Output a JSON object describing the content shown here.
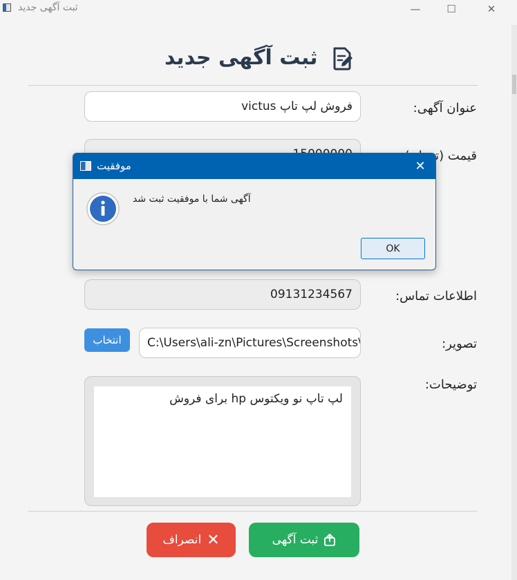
{
  "window": {
    "title": "ثبت آگهی جدید"
  },
  "form": {
    "heading": "ثبت آگهی جدید",
    "fields": {
      "title": {
        "label": "عنوان آگهی:",
        "value": "فروش لپ تاپ victus"
      },
      "price": {
        "label": "قیمت (تومان):",
        "value": "15000000"
      },
      "contact": {
        "label": "اطلاعات تماس:",
        "value": "09131234567"
      },
      "image": {
        "label": "تصویر:",
        "value": "C:\\Users\\ali-zn\\Pictures\\Screenshots\\Screenshot",
        "button": "انتخاب"
      },
      "description": {
        "label": "توضیحات:",
        "value": "لپ تاپ نو ویکتوس hp برای فروش"
      }
    },
    "buttons": {
      "submit": "ثبت آگهی",
      "cancel": "انصراف"
    }
  },
  "dialog": {
    "title": "موفقیت",
    "message": "آگهی شما با موفقیت ثبت شد",
    "ok": "OK"
  },
  "colors": {
    "submit": "#27ae60",
    "cancel": "#e74c3c",
    "dialog_titlebar": "#0063b1",
    "choose_button": "#3d8fe0"
  },
  "icons": {
    "heading": "edit-document-icon",
    "dialog": "info-icon",
    "submit": "upload-icon",
    "cancel": "close-icon"
  }
}
